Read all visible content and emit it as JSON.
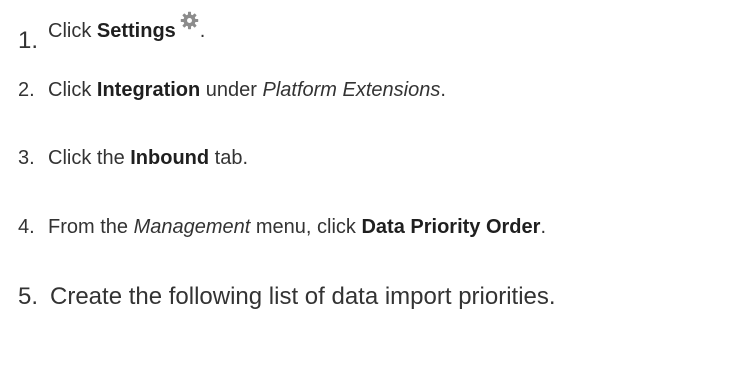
{
  "steps": [
    {
      "number": "1.",
      "prefix": "Click ",
      "bold": "Settings",
      "suffix": "."
    },
    {
      "number": "2.",
      "prefix": "Click ",
      "bold": "Integration",
      "middle": " under ",
      "italic": "Platform Extensions",
      "suffix": "."
    },
    {
      "number": "3.",
      "prefix": "Click the ",
      "bold": "Inbound",
      "suffix": " tab."
    },
    {
      "number": "4.",
      "prefix": "From the ",
      "italic": "Management",
      "middle": " menu, click ",
      "bold": "Data Priority Order",
      "suffix": "."
    },
    {
      "number": "5.",
      "text": "Create the following list of data import priorities."
    }
  ],
  "icons": {
    "settings": "gear-icon"
  },
  "colors": {
    "text": "#333333",
    "bold_text": "#1f1f1f",
    "gear": "#8c8c8c"
  }
}
